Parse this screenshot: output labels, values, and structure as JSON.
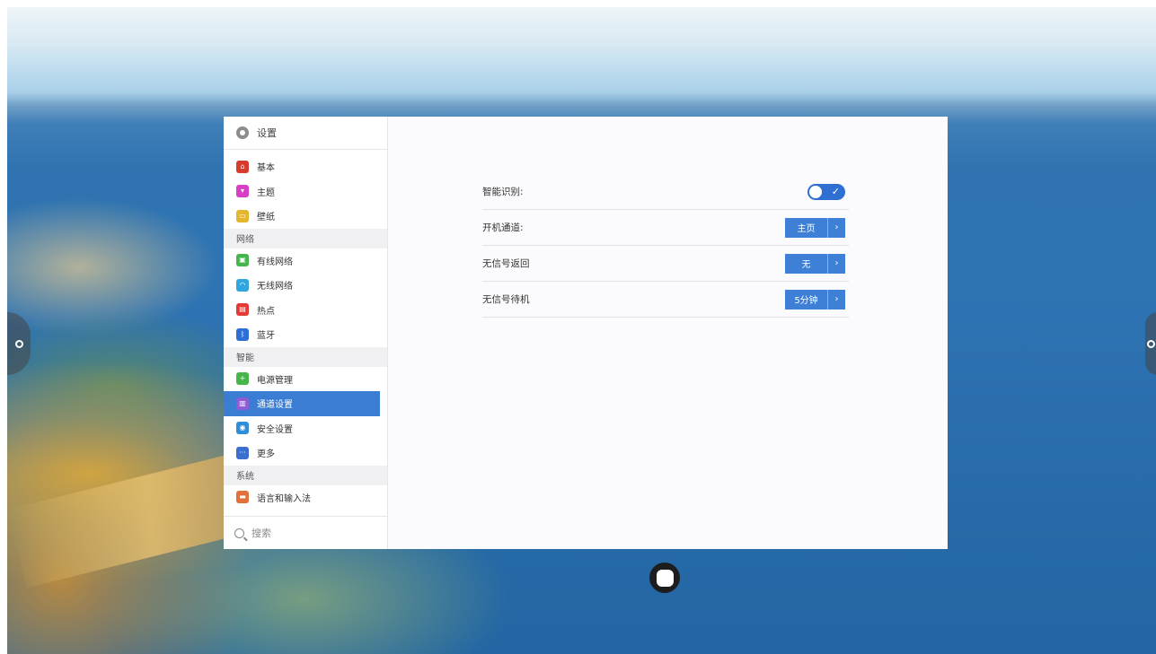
{
  "sidebar": {
    "title": "设置",
    "groups": [
      {
        "section": "",
        "items": [
          {
            "label": "基本",
            "icon": "home-icon",
            "color": "#d83a2e",
            "glyph": "⌂"
          },
          {
            "label": "主题",
            "icon": "shirt-icon",
            "color": "#d63fc6",
            "glyph": "▾"
          },
          {
            "label": "壁纸",
            "icon": "image-icon",
            "color": "#e3b62b",
            "glyph": "▭"
          }
        ]
      },
      {
        "section": "网络",
        "items": [
          {
            "label": "有线网络",
            "icon": "ethernet-icon",
            "color": "#43b649",
            "glyph": "▣"
          },
          {
            "label": "无线网络",
            "icon": "wifi-icon",
            "color": "#2fa7de",
            "glyph": "◠"
          },
          {
            "label": "热点",
            "icon": "hotspot-icon",
            "color": "#e53935",
            "glyph": "▤"
          },
          {
            "label": "蓝牙",
            "icon": "bluetooth-icon",
            "color": "#2c6fd6",
            "glyph": "ᛒ"
          }
        ]
      },
      {
        "section": "智能",
        "items": [
          {
            "label": "电源管理",
            "icon": "power-icon",
            "color": "#46b54a",
            "glyph": "+"
          },
          {
            "label": "通道设置",
            "icon": "channel-icon",
            "color": "#8f5bd6",
            "glyph": "▥",
            "active": true
          },
          {
            "label": "安全设置",
            "icon": "shield-icon",
            "color": "#2f8ed8",
            "glyph": "◉"
          },
          {
            "label": "更多",
            "icon": "more-icon",
            "color": "#3a6fd0",
            "glyph": "···"
          }
        ]
      },
      {
        "section": "系统",
        "items": [
          {
            "label": "语言和输入法",
            "icon": "keyboard-icon",
            "color": "#e2703a",
            "glyph": "▬"
          }
        ]
      }
    ],
    "search_placeholder": "搜索"
  },
  "settings": {
    "smart_recognition": {
      "label": "智能识别:",
      "enabled": true
    },
    "boot_channel": {
      "label": "开机通道:",
      "value": "主页"
    },
    "no_signal_return": {
      "label": "无信号返回",
      "value": "无"
    },
    "no_signal_standby": {
      "label": "无信号待机",
      "value": "5分钟"
    }
  },
  "colors": {
    "accent": "#3b7dd3",
    "toggle_on": "#2f6fd1"
  }
}
